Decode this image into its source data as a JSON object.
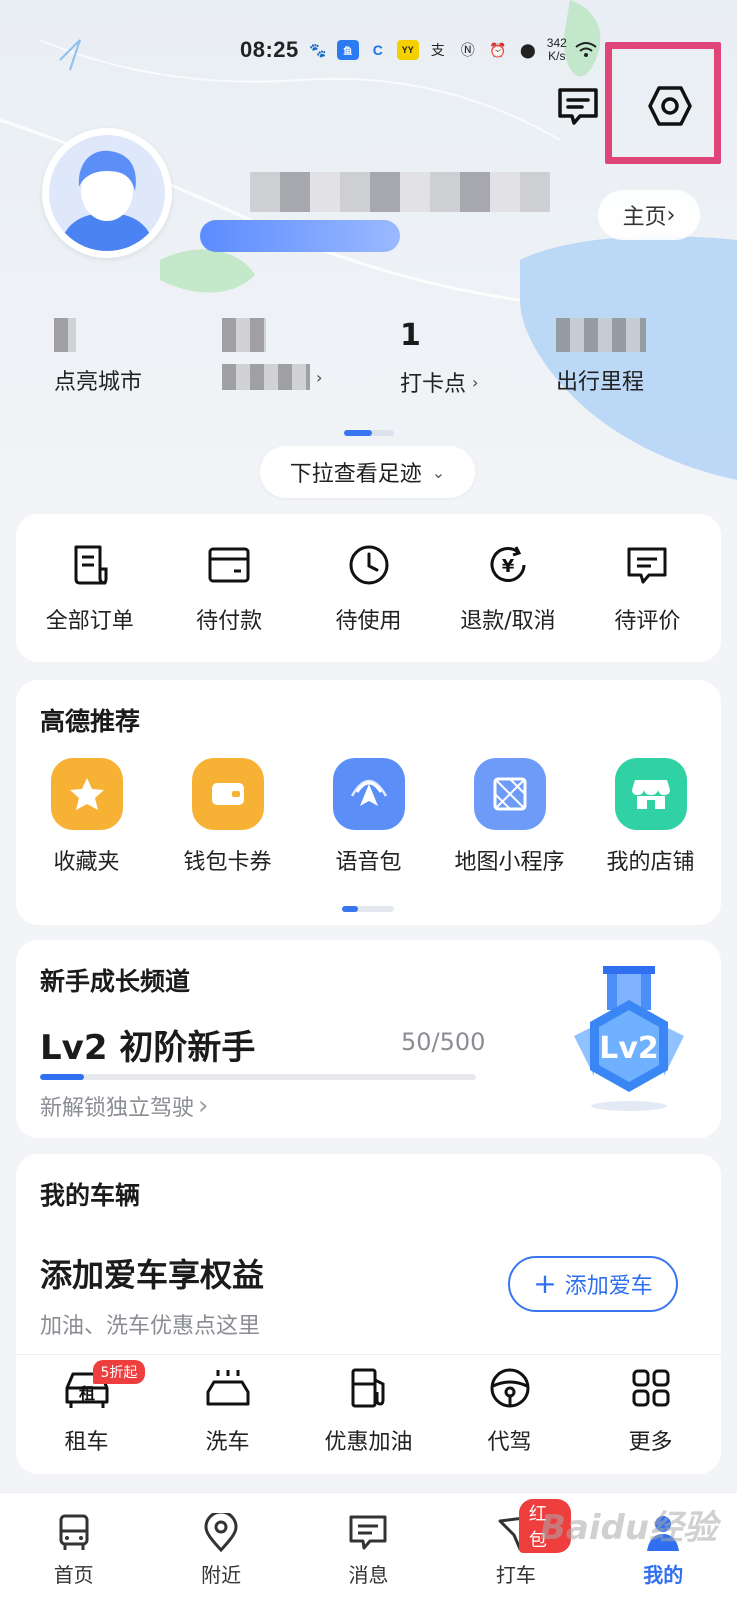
{
  "status_bar": {
    "time": "08:25",
    "net_speed_value": "342",
    "net_speed_unit": "K/s",
    "app_icons": [
      "baidu-paw-icon",
      "xianyu-app-icon",
      "c-app-icon",
      "yy-app-icon",
      "alipay-icon",
      "nfc-icon",
      "alarm-icon",
      "location-icon",
      "wifi-icon",
      "signal-icon",
      "battery-icon"
    ]
  },
  "header": {
    "homepage_label": "主页",
    "pulldown_label": "下拉查看足迹"
  },
  "stats": [
    {
      "label": "点亮城市",
      "value": ""
    },
    {
      "label": "",
      "value": ""
    },
    {
      "label": "打卡点",
      "value": "1"
    },
    {
      "label": "出行里程",
      "value": ""
    }
  ],
  "orders": [
    {
      "label": "全部订单",
      "icon": "order-list-icon"
    },
    {
      "label": "待付款",
      "icon": "wallet-icon"
    },
    {
      "label": "待使用",
      "icon": "clock-icon"
    },
    {
      "label": "退款/取消",
      "icon": "refund-icon"
    },
    {
      "label": "待评价",
      "icon": "comment-icon"
    }
  ],
  "recommend": {
    "title": "高德推荐",
    "items": [
      {
        "label": "收藏夹",
        "icon": "star-icon",
        "color": "#f7b236"
      },
      {
        "label": "钱包卡券",
        "icon": "wallet-card-icon",
        "color": "#f7b236"
      },
      {
        "label": "语音包",
        "icon": "voice-pack-icon",
        "color": "#5b8ff7"
      },
      {
        "label": "地图小程序",
        "icon": "mini-program-icon",
        "color": "#6e9bf7"
      },
      {
        "label": "我的店铺",
        "icon": "store-icon",
        "color": "#2fd1a5"
      }
    ]
  },
  "growth": {
    "title": "新手成长频道",
    "level": "Lv2 初阶新手",
    "progress_text": "50/500",
    "progress_fraction": 0.1,
    "unlock": "新解锁独立驾驶",
    "medal_label": "Lv2"
  },
  "vehicle": {
    "title": "我的车辆",
    "headline": "添加爱车享权益",
    "subtitle": "加油、洗车优惠点这里",
    "add_button": "添加爱车",
    "services": [
      {
        "label": "租车",
        "icon": "rent-car-icon",
        "badge": "5折起"
      },
      {
        "label": "洗车",
        "icon": "car-wash-icon"
      },
      {
        "label": "优惠加油",
        "icon": "fuel-icon"
      },
      {
        "label": "代驾",
        "icon": "steering-wheel-icon"
      },
      {
        "label": "更多",
        "icon": "grid-more-icon"
      }
    ],
    "rent_car_glyph": "租"
  },
  "bottom_nav": [
    {
      "label": "首页",
      "icon": "bus-icon"
    },
    {
      "label": "附近",
      "icon": "location-pin-icon"
    },
    {
      "label": "消息",
      "icon": "message-icon"
    },
    {
      "label": "打车",
      "icon": "taxi-icon",
      "badge": "红包"
    },
    {
      "label": "我的",
      "icon": "user-icon",
      "active": true
    }
  ],
  "colors": {
    "accent": "#2f6ff0",
    "highlight_box": "#e0457a",
    "badge_red": "#ef3e3e"
  },
  "watermark": "Baidu经验"
}
